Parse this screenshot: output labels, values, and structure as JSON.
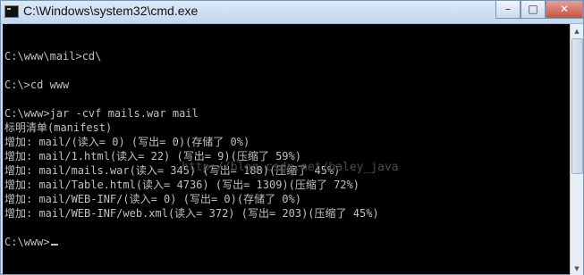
{
  "window": {
    "title": "C:\\Windows\\system32\\cmd.exe",
    "buttons": {
      "minimize": "–",
      "maximize": "□",
      "close": "✕"
    }
  },
  "console": {
    "lines": [
      "",
      "C:\\www\\mail>cd\\",
      "",
      "C:\\>cd www",
      "",
      "C:\\www>jar -cvf mails.war mail",
      "标明清单(manifest)",
      "增加: mail/(读入= 0) (写出= 0)(存储了 0%)",
      "增加: mail/1.html(读入= 22) (写出= 9)(压缩了 59%)",
      "增加: mail/mails.war(读入= 345) (写出= 188)(压缩了 45%)",
      "增加: mail/Table.html(读入= 4736) (写出= 1309)(压缩了 72%)",
      "增加: mail/WEB-INF/(读入= 0) (写出= 0)(存储了 0%)",
      "增加: mail/WEB-INF/web.xml(读入= 372) (写出= 203)(压缩了 45%)",
      "",
      "C:\\www>"
    ],
    "watermark": "http://blog.csdn.net/haley_java"
  },
  "colors": {
    "console_bg": "#000000",
    "console_fg": "#c0c0c0"
  }
}
